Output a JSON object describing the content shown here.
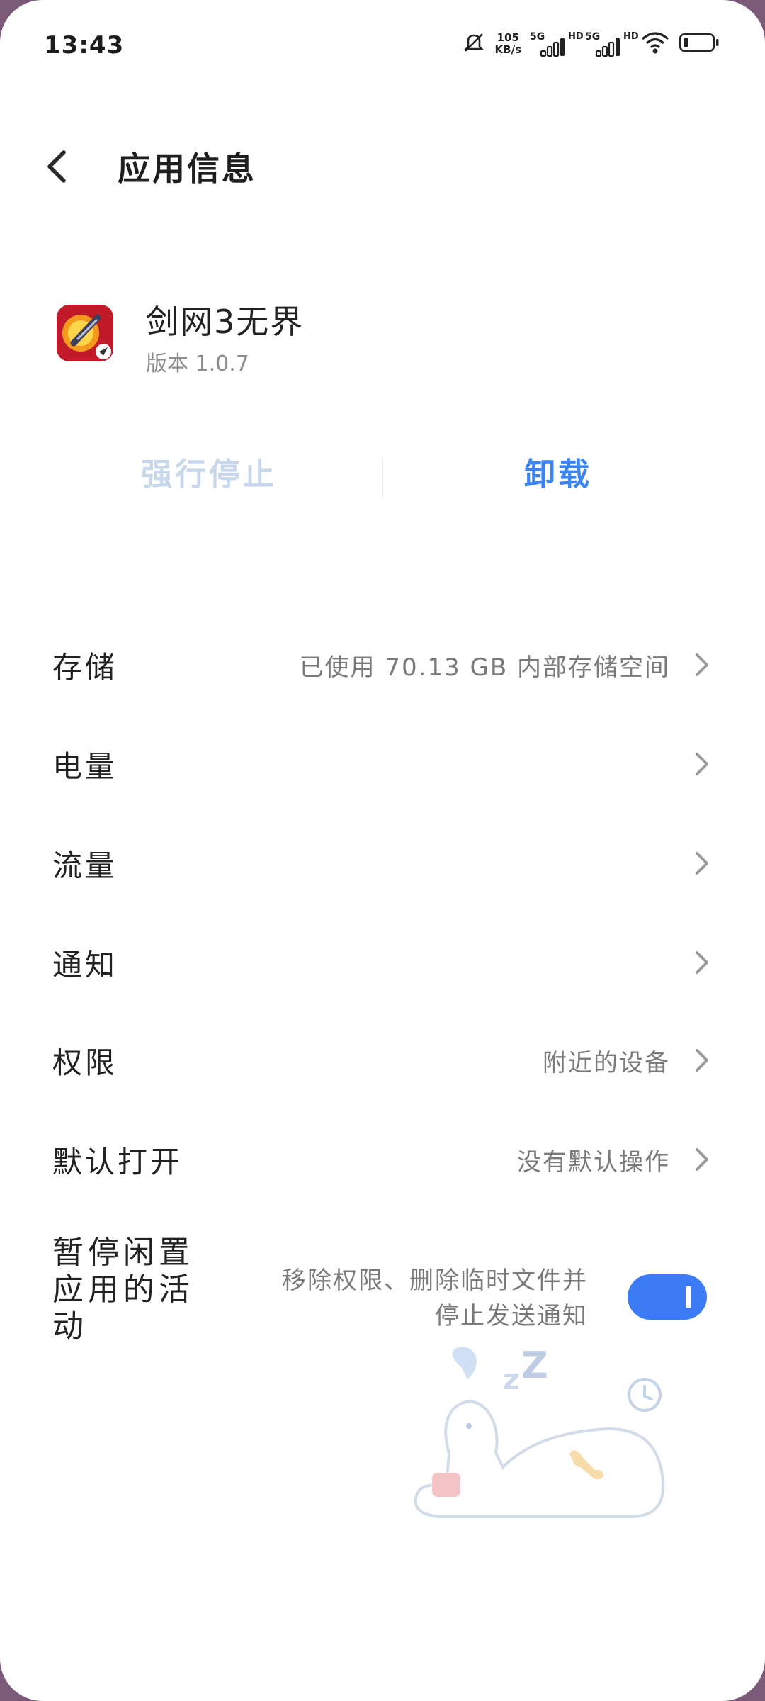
{
  "status_bar": {
    "time": "13:43",
    "net_speed_value": "105",
    "net_speed_unit": "KB/s",
    "sim1_type": "5G",
    "sim2_type": "5G",
    "hd_label": "HD",
    "icons": [
      "mute-bell-icon",
      "signal-icon",
      "signal-icon",
      "wifi-icon",
      "battery-icon"
    ],
    "battery_level": 0.15
  },
  "header": {
    "title": "应用信息"
  },
  "app": {
    "name": "剑网3无界",
    "version": "版本 1.0.7"
  },
  "actions": {
    "force_stop": "强行停止",
    "uninstall": "卸载"
  },
  "rows": [
    {
      "label": "存储",
      "value": "已使用 70.13 GB 内部存储空间"
    },
    {
      "label": "电量",
      "value": ""
    },
    {
      "label": "流量",
      "value": ""
    },
    {
      "label": "通知",
      "value": ""
    },
    {
      "label": "权限",
      "value": "附近的设备"
    },
    {
      "label": "默认打开",
      "value": "没有默认操作"
    }
  ],
  "pause_activity": {
    "label": "暂停闲置应用的活动",
    "description": "移除权限、删除临时文件并停止发送通知",
    "enabled": true
  },
  "colors": {
    "accent": "#3d84f3",
    "toggle_on": "#3b7cf6",
    "disabled_text": "#c9d7ec"
  }
}
